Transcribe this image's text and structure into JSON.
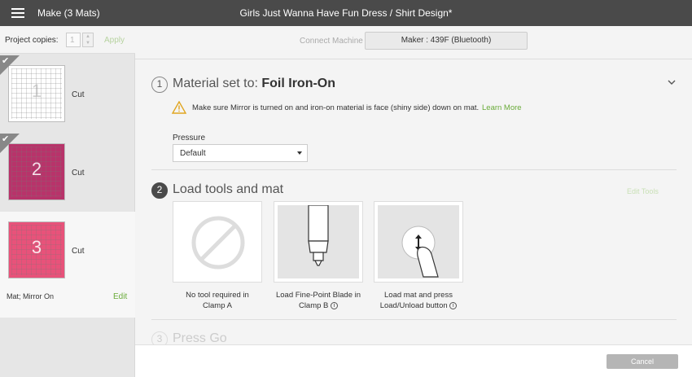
{
  "header": {
    "app_title": "Make (3 Mats)",
    "document_title": "Girls Just Wanna Have Fun Dress / Shirt Design*"
  },
  "sidebar": {
    "copies_label": "Project copies:",
    "copies_value": "1",
    "apply_label": "Apply",
    "mats": [
      {
        "number": "1",
        "label": "Cut",
        "checked": true,
        "color": "#ffffff"
      },
      {
        "number": "2",
        "label": "Cut",
        "checked": true,
        "color": "#b8336a"
      },
      {
        "number": "3",
        "label": "Cut",
        "checked": false,
        "color": "#e8527a"
      }
    ],
    "selected_mat_info": "Mat; Mirror On",
    "edit_label": "Edit"
  },
  "machine": {
    "connect_label": "Connect Machine",
    "selected_machine": "Maker : 439F (Bluetooth)"
  },
  "step1": {
    "number": "1",
    "title_prefix": "Material set to: ",
    "material": "Foil Iron-On",
    "warning": "Make sure Mirror is turned on and iron-on material is face (shiny side) down on mat.",
    "learn_more": "Learn More",
    "pressure_label": "Pressure",
    "pressure_value": "Default"
  },
  "step2": {
    "number": "2",
    "title": "Load tools and mat",
    "edit_tools": "Edit Tools",
    "tools": [
      {
        "line1": "No tool required in",
        "line2": "Clamp A",
        "icon": "no-tool-icon"
      },
      {
        "line1": "Load Fine-Point Blade in",
        "line2": "Clamp B",
        "icon": "fine-point-blade-icon"
      },
      {
        "line1": "Load mat and press",
        "line2": "Load/Unload button",
        "icon": "load-button-icon"
      }
    ]
  },
  "step3": {
    "number": "3",
    "title": "Press Go"
  },
  "footer": {
    "cancel_label": "Cancel"
  },
  "colors": {
    "accent_green": "#6aab3a",
    "topbar": "#4a4a4a"
  }
}
